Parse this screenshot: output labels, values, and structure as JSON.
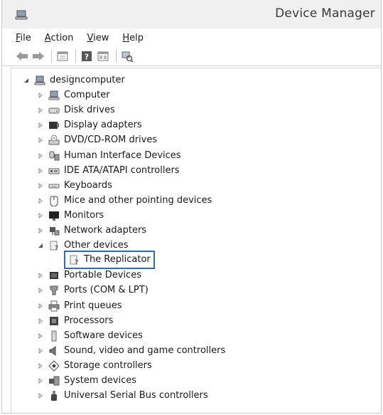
{
  "window": {
    "title": "Device Manager",
    "icon": "device-manager-icon"
  },
  "menu": {
    "items": [
      {
        "label_accel": "F",
        "label_rest": "ile"
      },
      {
        "label_accel": "A",
        "label_rest": "ction"
      },
      {
        "label_accel": "V",
        "label_rest": "iew"
      },
      {
        "label_accel": "H",
        "label_rest": "elp"
      }
    ]
  },
  "toolbar": {
    "buttons": [
      "back-arrow-icon",
      "forward-arrow-icon",
      "properties-icon",
      "help-icon",
      "view-icon",
      "scan-hardware-icon"
    ]
  },
  "tree": {
    "root": {
      "label": "designcomputer",
      "expanded": true,
      "icon": "computer-icon"
    },
    "children": [
      {
        "label": "Computer",
        "icon": "computer-icon",
        "expanded": false
      },
      {
        "label": "Disk drives",
        "icon": "disk-drive-icon",
        "expanded": false
      },
      {
        "label": "Display adapters",
        "icon": "display-adapter-icon",
        "expanded": false
      },
      {
        "label": "DVD/CD-ROM drives",
        "icon": "dvd-drive-icon",
        "expanded": false
      },
      {
        "label": "Human Interface Devices",
        "icon": "hid-icon",
        "expanded": false
      },
      {
        "label": "IDE ATA/ATAPI controllers",
        "icon": "ide-controller-icon",
        "expanded": false
      },
      {
        "label": "Keyboards",
        "icon": "keyboard-icon",
        "expanded": false
      },
      {
        "label": "Mice and other pointing devices",
        "icon": "mouse-icon",
        "expanded": false
      },
      {
        "label": "Monitors",
        "icon": "monitor-icon",
        "expanded": false
      },
      {
        "label": "Network adapters",
        "icon": "network-adapter-icon",
        "expanded": false
      },
      {
        "label": "Other devices",
        "icon": "unknown-device-icon",
        "expanded": true,
        "children": [
          {
            "label": "The Replicator",
            "icon": "unknown-device-icon",
            "selected": true
          }
        ]
      },
      {
        "label": "Portable Devices",
        "icon": "portable-device-icon",
        "expanded": false
      },
      {
        "label": "Ports (COM & LPT)",
        "icon": "port-icon",
        "expanded": false
      },
      {
        "label": "Print queues",
        "icon": "printer-icon",
        "expanded": false
      },
      {
        "label": "Processors",
        "icon": "processor-icon",
        "expanded": false
      },
      {
        "label": "Software devices",
        "icon": "software-device-icon",
        "expanded": false
      },
      {
        "label": "Sound, video and game controllers",
        "icon": "speaker-icon",
        "expanded": false
      },
      {
        "label": "Storage controllers",
        "icon": "storage-controller-icon",
        "expanded": false
      },
      {
        "label": "System devices",
        "icon": "system-device-icon",
        "expanded": false
      },
      {
        "label": "Universal Serial Bus controllers",
        "icon": "usb-icon",
        "expanded": false
      }
    ]
  },
  "colors": {
    "selection_border": "#2b6cbf",
    "titlebar_bg": "#f0f0f0"
  }
}
